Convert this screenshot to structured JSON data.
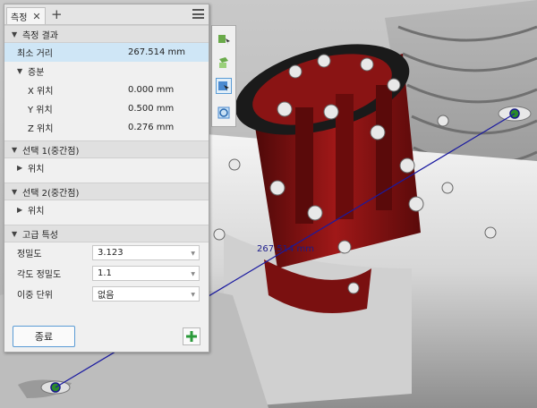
{
  "tab": {
    "label": "측정",
    "close": "✕",
    "add": "+"
  },
  "sections": {
    "result": "측정 결과",
    "delta": "증분",
    "selection1": "선택 1(중간점)",
    "selection2": "선택 2(중간점)",
    "advanced": "고급 특성"
  },
  "result": {
    "min_distance_label": "최소 거리",
    "min_distance_value": "267.514 mm"
  },
  "delta": {
    "x_label": "X 위치",
    "x_value": "0.000 mm",
    "y_label": "Y 위치",
    "y_value": "0.500 mm",
    "z_label": "Z 위치",
    "z_value": "0.276 mm"
  },
  "selection1": {
    "position_label": "위치"
  },
  "selection2": {
    "position_label": "위치"
  },
  "advanced": {
    "precision_label": "정밀도",
    "precision_value": "3.123",
    "angle_precision_label": "각도 정밀도",
    "angle_precision_value": "1.1",
    "dual_unit_label": "이중 단위",
    "dual_unit_value": "없음"
  },
  "buttons": {
    "done": "종료"
  },
  "viewport": {
    "measure_label": "267.514 mm"
  },
  "colors": {
    "flange": "#8a1414",
    "measure_line": "#1a1aa0",
    "accent": "#5a9bd5"
  }
}
